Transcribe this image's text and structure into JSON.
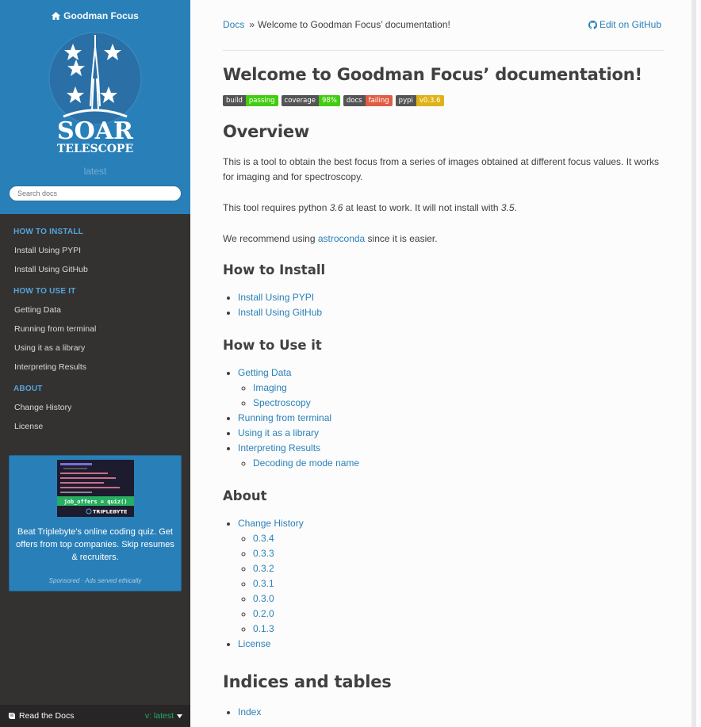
{
  "sidebar": {
    "project_name": "Goodman Focus",
    "logo_text_main": "SOAR",
    "logo_text_sub": "TELESCOPE",
    "version": "latest",
    "search_placeholder": "Search docs",
    "sections": [
      {
        "caption": "HOW TO INSTALL",
        "items": [
          "Install Using PYPI",
          "Install Using GitHub"
        ]
      },
      {
        "caption": "HOW TO USE IT",
        "items": [
          "Getting Data",
          "Running from terminal",
          "Using it as a library",
          "Interpreting Results"
        ]
      },
      {
        "caption": "ABOUT",
        "items": [
          "Change History",
          "License"
        ]
      }
    ],
    "ad": {
      "image_caption": "job_offers = quiz()",
      "image_brand": "TRIPLEBYTE",
      "text": "Beat Triplebyte's online coding quiz. Get offers from top companies. Skip resumes & recruiters.",
      "sponsor": "Sponsored · Ads served ethically"
    },
    "rtd": {
      "label": "Read the Docs",
      "version": "v: latest"
    }
  },
  "breadcrumbs": {
    "root": "Docs",
    "separator": "»",
    "current": "Welcome to Goodman Focus’ documentation!",
    "edit": "Edit on GitHub"
  },
  "page": {
    "title": "Welcome to Goodman Focus’ documentation!",
    "badges": [
      {
        "left": "build",
        "right": "passing",
        "color": "#4c1"
      },
      {
        "left": "coverage",
        "right": "98%",
        "color": "#4c1"
      },
      {
        "left": "docs",
        "right": "failing",
        "color": "#e05d44"
      },
      {
        "left": "pypi",
        "right": "v0.3.6",
        "color": "#dfb317"
      }
    ],
    "overview": {
      "heading": "Overview",
      "p1": "This is a tool to obtain the best focus from a series of images obtained at different focus values. It works for imaging and for spectroscopy.",
      "p2_a": "This tool requires python ",
      "p2_v1": "3.6",
      "p2_b": " at least to work. It will not install with ",
      "p2_v2": "3.5",
      "p2_c": ".",
      "p3_a": "We recommend using ",
      "p3_link": "astroconda",
      "p3_b": " since it is easier."
    },
    "install": {
      "heading": "How to Install",
      "items": [
        "Install Using PYPI",
        "Install Using GitHub"
      ]
    },
    "use": {
      "heading": "How to Use it",
      "items": [
        {
          "label": "Getting Data",
          "children": [
            "Imaging",
            "Spectroscopy"
          ]
        },
        {
          "label": "Running from terminal",
          "children": []
        },
        {
          "label": "Using it as a library",
          "children": []
        },
        {
          "label": "Interpreting Results",
          "children": [
            "Decoding de mode name"
          ]
        }
      ]
    },
    "about": {
      "heading": "About",
      "items": [
        {
          "label": "Change History",
          "children": [
            "0.3.4",
            "0.3.3",
            "0.3.2",
            "0.3.1",
            "0.3.0",
            "0.2.0",
            "0.1.3"
          ]
        },
        {
          "label": "License",
          "children": []
        }
      ]
    },
    "indices": {
      "heading": "Indices and tables",
      "items": [
        "Index"
      ]
    }
  },
  "colors": {
    "sidebar_top": "#2980b9",
    "sidebar_bg": "#343131",
    "link": "#2980b9",
    "caption": "#55a5d9"
  }
}
